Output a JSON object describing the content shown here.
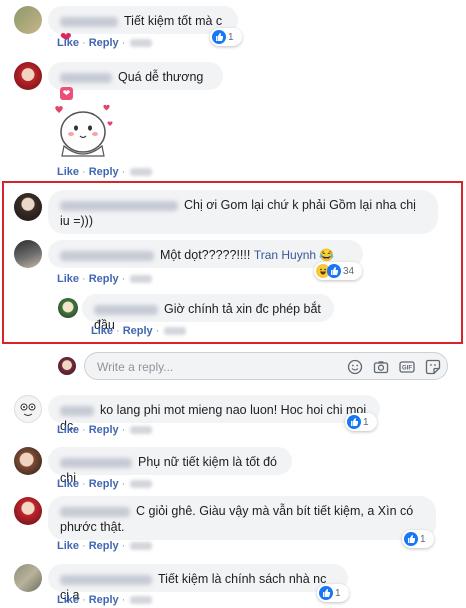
{
  "actions": {
    "like": "Like",
    "reply": "Reply"
  },
  "comments": [
    {
      "text": "Tiết kiệm tốt mà c",
      "reaction_count": "1"
    },
    {
      "text": "Quá dễ thương",
      "reaction_count": ""
    },
    {
      "text": "Chị ơi Gom lại chứ k phải Gồm lại nha chị iu =)))"
    },
    {
      "text": "Một dọt?????!!!! ",
      "tag": "Tran Huynh",
      "reaction_count": "34"
    },
    {
      "text": "Giờ chính tả xin đc phép bắt đầu"
    },
    {
      "text": "ko lang phi mot mieng nao luon! Hoc hoi chi moi dc.",
      "reaction_count": "1"
    },
    {
      "text": "Phụ nữ tiết kiệm là tốt đó chị"
    },
    {
      "text": "C giỏi ghê. Giàu vậy mà vẫn bít tiết kiệm, a Xìn có phước thật.",
      "reaction_count": "1"
    },
    {
      "text": "Tiết kiệm là chính sách nhà nc cj a",
      "reaction_count": "1"
    }
  ],
  "reply_input": {
    "placeholder": "Write a reply..."
  },
  "colors": {
    "highlight": "#d8232a",
    "link": "#4267b2",
    "bubble": "#f2f3f5"
  }
}
